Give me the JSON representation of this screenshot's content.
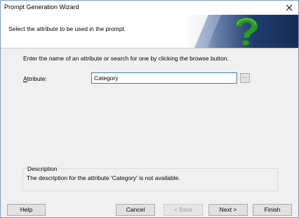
{
  "window": {
    "title": "Prompt Generation Wizard"
  },
  "header": {
    "subtitle": "Select the attribute to be used in the prompt.",
    "graphic_icon": "question-mark-icon"
  },
  "body": {
    "instruction": "Enter the name of an attribute or search for one by clicking the browse button.",
    "attribute_label_accel": "A",
    "attribute_label_rest": "ttribute:",
    "attribute_value": "Category",
    "browse_label": "..."
  },
  "description": {
    "legend": "Description",
    "text": "The description for the attribute 'Category' is not available."
  },
  "buttons": {
    "help": "Help",
    "cancel": "Cancel",
    "back": "< Back",
    "next": "Next >",
    "finish": "Finish"
  },
  "colors": {
    "window_bg": "#f0f0f0",
    "header_blue_dark": "#1f3c6e",
    "question_mark": "#2a9a2a",
    "input_border_focus": "#3c7fb1"
  }
}
